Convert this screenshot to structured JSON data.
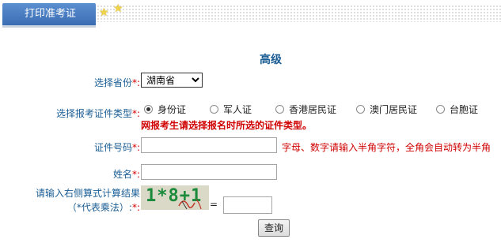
{
  "tab": {
    "label": "打印准考证"
  },
  "title": "高级",
  "province": {
    "label": "选择省份",
    "required": "*:",
    "selected": "湖南省"
  },
  "cert_type": {
    "label": "选择报考证件类型",
    "required": "*:",
    "options": [
      "身份证",
      "军人证",
      "香港居民证",
      "澳门居民证",
      "台胞证"
    ],
    "selected_index": 0,
    "warning": "网报考生请选择报名时所选的证件类型。"
  },
  "id_number": {
    "label": "证件号码",
    "required": "*:",
    "value": "",
    "hint": "字母、数字请输入半角字符，全角会自动转为半角"
  },
  "name": {
    "label": "姓名",
    "required": "*:",
    "value": ""
  },
  "captcha": {
    "label_line1": "请输入右侧算式计算结果",
    "label_line2": "（*代表乘法）:",
    "required": "*:",
    "image_text": "1*8+1",
    "equals": "=",
    "value": ""
  },
  "query_button": {
    "label": "查询"
  },
  "colors": {
    "accent": "#1a5d94",
    "required": "#d00000",
    "tab": "#3a6db3",
    "captcha_text": "#1b8a3b"
  }
}
